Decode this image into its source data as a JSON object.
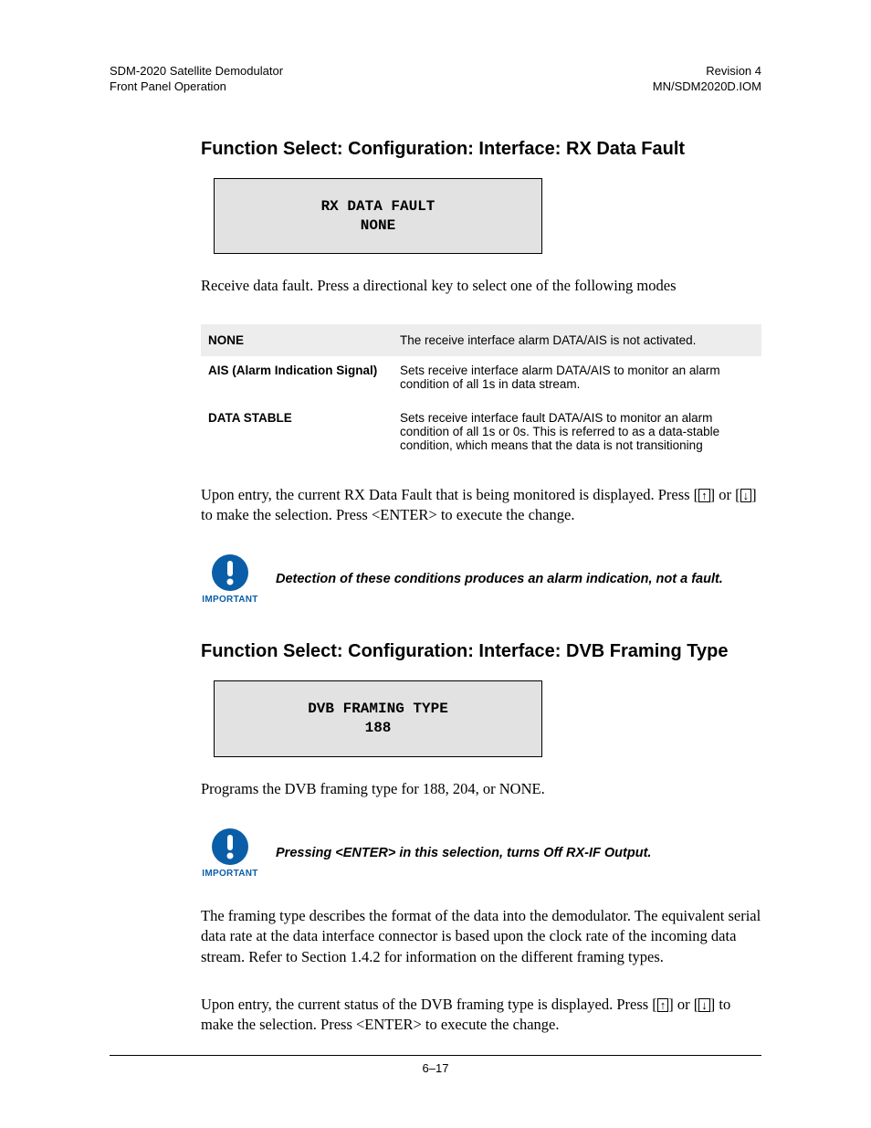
{
  "header": {
    "left1": "SDM-2020 Satellite Demodulator",
    "left2": "Front Panel Operation",
    "right1": "Revision 4",
    "right2": "MN/SDM2020D.IOM"
  },
  "section1": {
    "heading": "Function Select: Configuration: Interface: RX Data Fault",
    "display_line1": "RX DATA FAULT",
    "display_line2": "NONE",
    "intro": "Receive data fault. Press a directional key to select one of the following modes",
    "table": [
      {
        "term": "NONE",
        "desc": "The receive interface alarm DATA/AIS is not activated."
      },
      {
        "term": "AIS (Alarm Indication Signal)",
        "desc": "Sets receive interface alarm DATA/AIS to monitor an alarm condition of all 1s in data stream."
      },
      {
        "term": "DATA STABLE",
        "desc": "Sets receive interface fault DATA/AIS to monitor an alarm condition of all 1s or 0s. This is referred to as a data-stable condition, which means that the data is not transitioning"
      }
    ],
    "post": {
      "pre_up": "Upon entry, the current RX Data Fault that is being monitored is displayed. Press [",
      "mid": "] or [",
      "post_down": "] to make the selection. Press <ENTER> to execute the change."
    },
    "important_label": "IMPORTANT",
    "important_msg": "Detection of these conditions produces an alarm indication, not a fault."
  },
  "section2": {
    "heading": "Function Select: Configuration: Interface: DVB Framing Type",
    "display_line1": "DVB FRAMING TYPE",
    "display_line2": "188",
    "intro": "Programs the DVB framing type for 188, 204, or NONE.",
    "important_label": "IMPORTANT",
    "important_msg": "Pressing <ENTER> in this selection, turns Off RX-IF Output.",
    "para1": "The framing type describes the format of the data into the demodulator. The equivalent serial data rate at the data interface connector is based upon the clock rate of the incoming data stream. Refer to Section 1.4.2 for information on the different framing types.",
    "post": {
      "pre_up": "Upon entry, the current status of the DVB framing type is displayed. Press [",
      "mid": "] or [",
      "post_down": "] to make the selection. Press <ENTER> to execute the change."
    }
  },
  "footer": "6–17",
  "icons": {
    "important": "exclamation-circle-icon",
    "up_arrow": "↑",
    "down_arrow": "↓"
  }
}
